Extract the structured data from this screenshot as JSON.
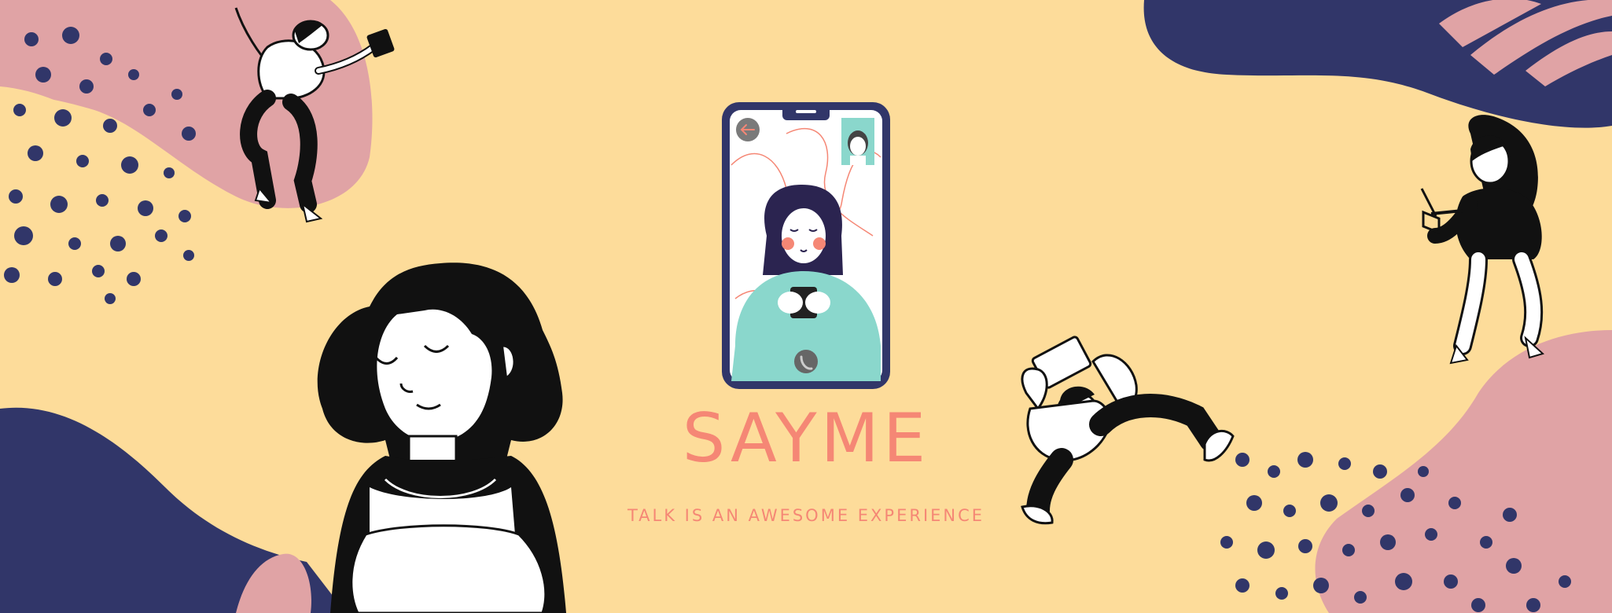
{
  "brand": {
    "name": "SAYME",
    "tagline": "TALK IS AN AWESOME EXPERIENCE"
  },
  "colors": {
    "background": "#fddc9a",
    "navy": "#313669",
    "pink": "#e0a3a5",
    "coral": "#f58775",
    "teal": "#8ad7cc",
    "ink": "#111111"
  },
  "icons": {
    "back": "back-arrow-icon",
    "call": "phone-call-icon"
  }
}
